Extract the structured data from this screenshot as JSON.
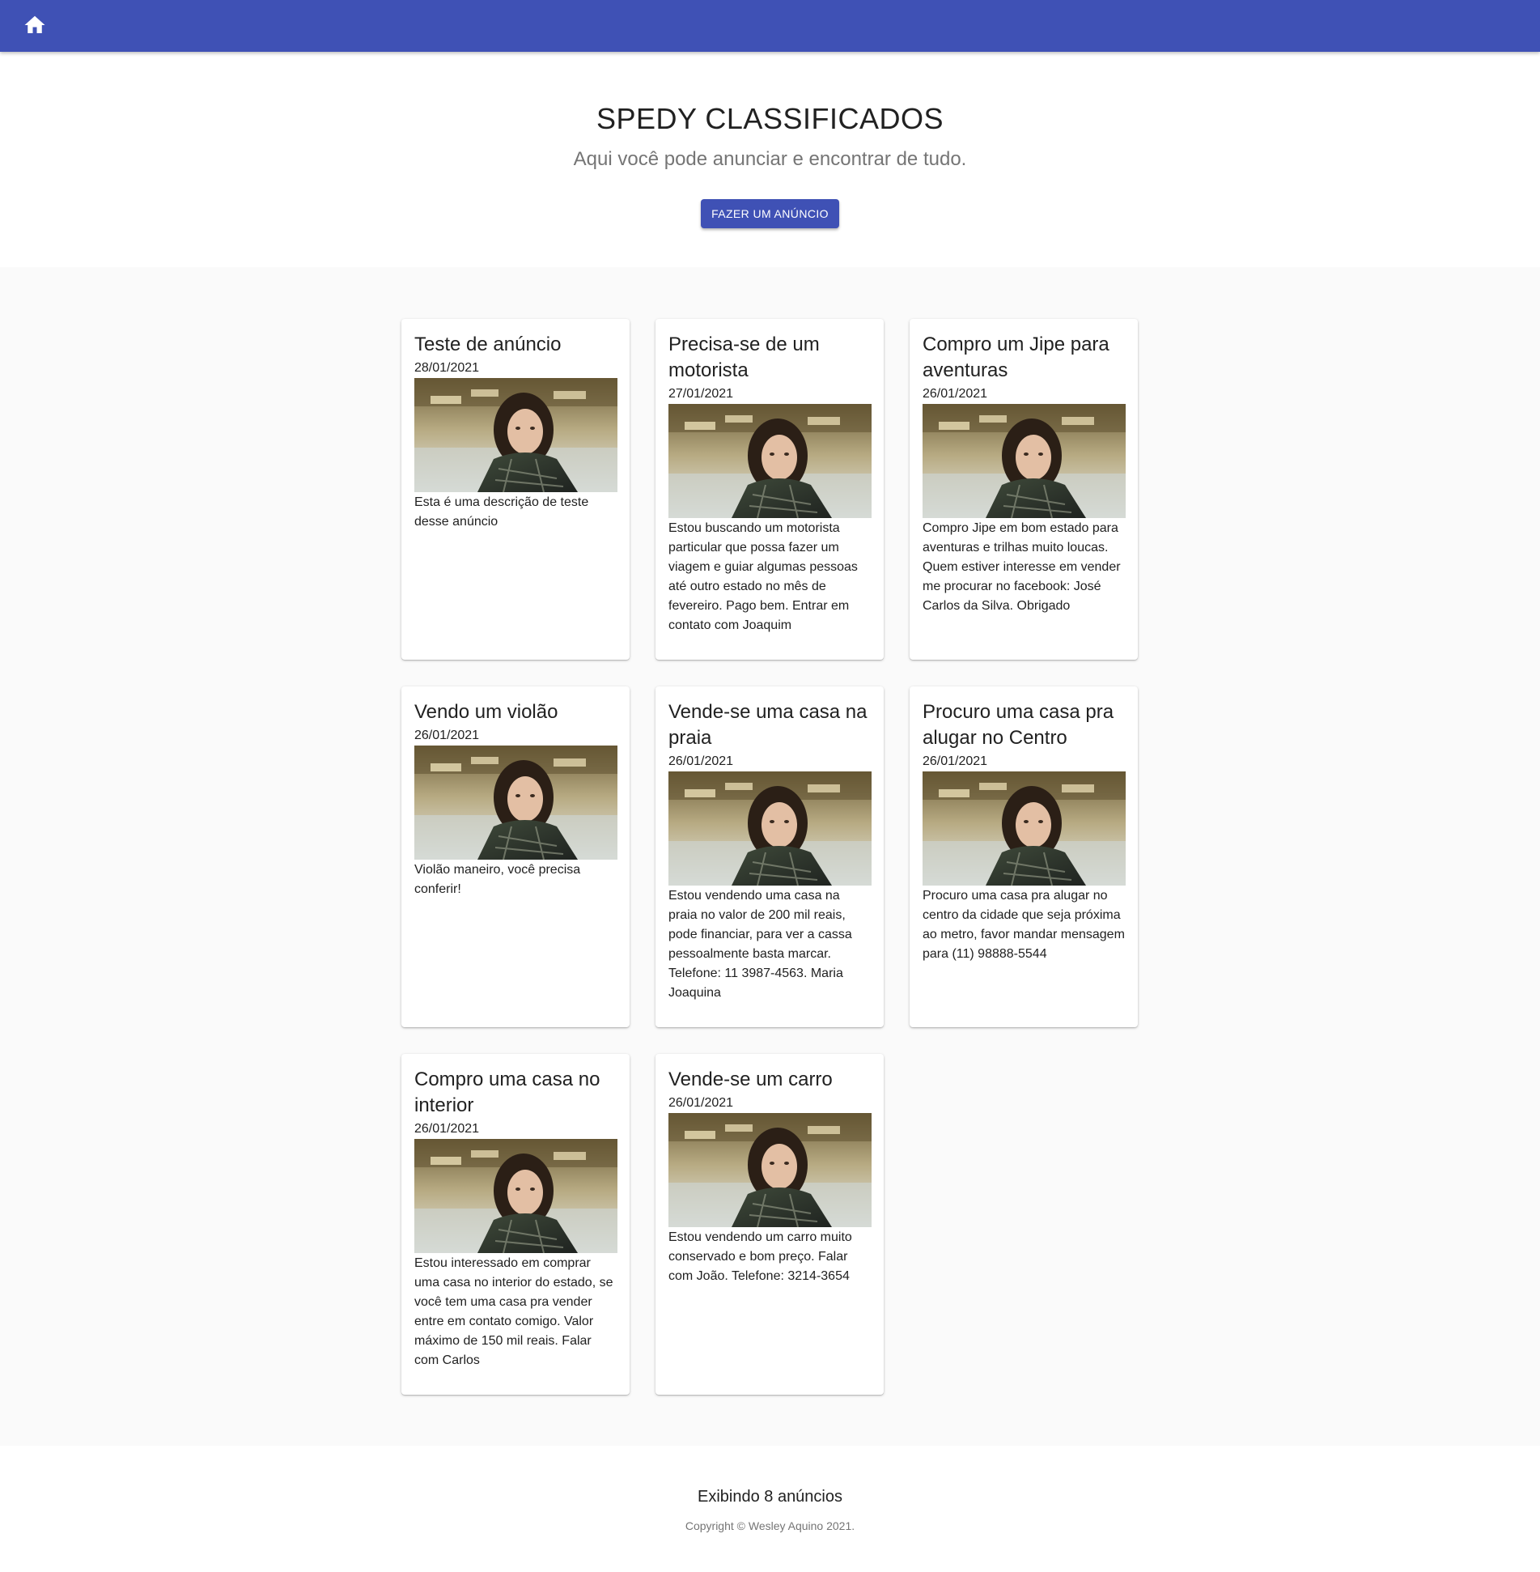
{
  "appbar": {
    "home_icon": "home-icon",
    "color": "#3f51b5"
  },
  "hero": {
    "title": "SPEDY CLASSIFICADOS",
    "subtitle": "Aqui você pode anunciar e encontrar de tudo.",
    "cta_label": "FAZER UM ANÚNCIO"
  },
  "ads": [
    {
      "title": "Teste de anúncio",
      "date": "28/01/2021",
      "description": "Esta é uma descrição de teste desse anúncio"
    },
    {
      "title": "Precisa-se de um motorista",
      "date": "27/01/2021",
      "description": "Estou buscando um motorista particular que possa fazer um viagem e guiar algumas pessoas até outro estado no mês de fevereiro. Pago bem. Entrar em contato com Joaquim"
    },
    {
      "title": "Compro um Jipe para aventuras",
      "date": "26/01/2021",
      "description": "Compro Jipe em bom estado para aventuras e trilhas muito loucas. Quem estiver interesse em vender me procurar no facebook: José Carlos da Silva. Obrigado"
    },
    {
      "title": "Vendo um violão",
      "date": "26/01/2021",
      "description": "Violão maneiro, você precisa conferir!"
    },
    {
      "title": "Vende-se uma casa na praia",
      "date": "26/01/2021",
      "description": "Estou vendendo uma casa na praia no valor de 200 mil reais, pode financiar, para ver a cassa pessoalmente basta marcar. Telefone: 11 3987-4563. Maria Joaquina"
    },
    {
      "title": "Procuro uma casa pra alugar no Centro",
      "date": "26/01/2021",
      "description": "Procuro uma casa pra alugar no centro da cidade que seja próxima ao metro, favor mandar mensagem para (11) 98888-5544"
    },
    {
      "title": "Compro uma casa no interior",
      "date": "26/01/2021",
      "description": "Estou interessado em comprar uma casa no interior do estado, se você tem uma casa pra vender entre em contato comigo. Valor máximo de 150 mil reais. Falar com Carlos"
    },
    {
      "title": "Vende-se um carro",
      "date": "26/01/2021",
      "description": "Estou vendendo um carro muito conservado e bom preço. Falar com João. Telefone: 3214-3654"
    }
  ],
  "footer": {
    "count_text": "Exibindo 8 anúncios",
    "copyright": "Copyright © Wesley Aquino 2021."
  }
}
